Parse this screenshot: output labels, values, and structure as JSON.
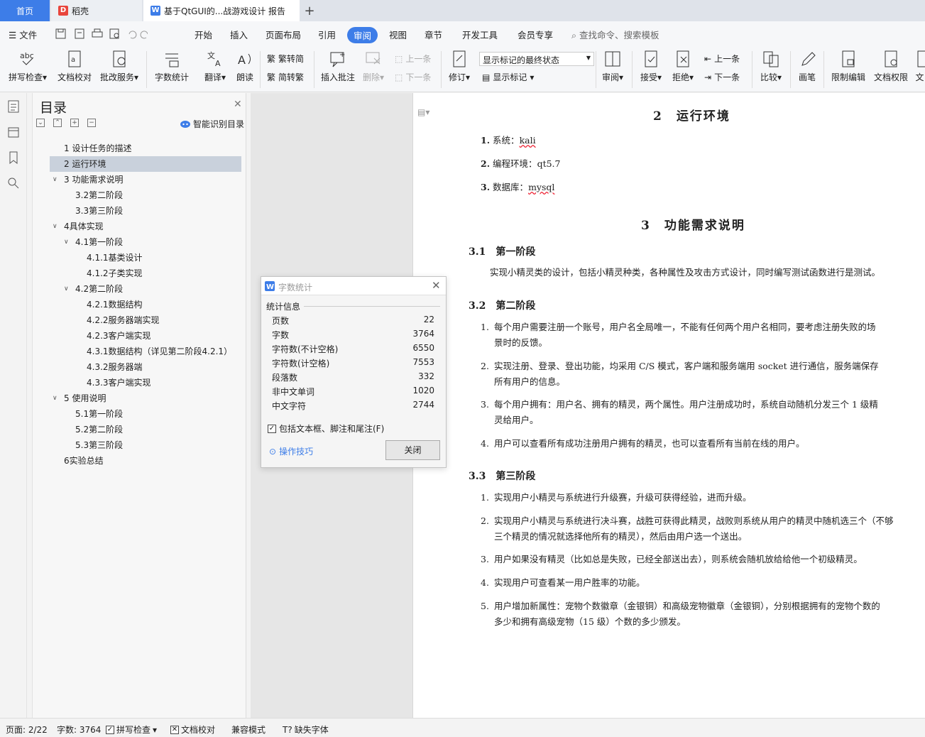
{
  "tabs": {
    "home": "首页",
    "daoke": "稻壳",
    "doc": "基于QtGUI的...战游戏设计 报告"
  },
  "menu": {
    "file": "文件",
    "items": [
      "开始",
      "插入",
      "页面布局",
      "引用",
      "审阅",
      "视图",
      "章节",
      "开发工具",
      "会员专享"
    ],
    "search": "查找命令、搜索模板"
  },
  "ribbon": {
    "spell": "拼写检查",
    "proof": "文档校对",
    "batch": "批改服务",
    "wordcount": "字数统计",
    "translate": "翻译",
    "read": "朗读",
    "trad": "繁转简",
    "simp": "简转繁",
    "insert_comment": "插入批注",
    "delete": "删除",
    "prev": "上一条",
    "next": "下一条",
    "revise": "修订",
    "markup_state": "显示标记的最终状态",
    "show_markup": "显示标记",
    "review": "审阅",
    "accept": "接受",
    "reject": "拒绝",
    "prev2": "上一条",
    "next2": "下一条",
    "compare": "比较",
    "pen": "画笔",
    "restrict": "限制编辑",
    "rights": "文档权限",
    "more": "文"
  },
  "toc": {
    "title": "目录",
    "smart": "智能识别目录",
    "items": [
      "1 设计任务的描述",
      "2 运行环境",
      "3 功能需求说明",
      "3.2第二阶段",
      "3.3第三阶段",
      "4具体实现",
      "4.1第一阶段",
      "4.1.1基类设计",
      "4.1.2子类实现",
      "4.2第二阶段",
      "4.2.1数据结构",
      "4.2.2服务器端实现",
      "4.2.3客户端实现",
      "4.3.1数据结构（详见第二阶段4.2.1）",
      "4.3.2服务器端",
      "4.3.3客户端实现",
      "5 使用说明",
      "5.1第一阶段",
      "5.2第二阶段",
      "5.3第三阶段",
      "6实验总结"
    ]
  },
  "doc": {
    "h_env": "2　运行环境",
    "env": [
      {
        "n": "1.",
        "label": "系统：",
        "val": "kali"
      },
      {
        "n": "2.",
        "label": "编程环境：",
        "val": "qt5.7"
      },
      {
        "n": "3.",
        "label": "数据库：",
        "val": "mysql"
      }
    ],
    "h_func": "3　功能需求说明",
    "s31": "3.1　第一阶段",
    "p31": "实现小精灵类的设计，包括小精灵种类，各种属性及攻击方式设计，同时编写测试函数进行是测试。",
    "s32": "3.2　第二阶段",
    "l32": [
      {
        "n": "1.",
        "a": "每个用户需要注册一个账号，用户名全局唯一，不能有任何两个用户名相同，要考虑注册失败的场",
        "b": "景时的反馈。"
      },
      {
        "n": "2.",
        "a": "实现注册、登录、登出功能，均采用 C/S 模式，客户端和服务端用 socket 进行通信，服务端保存",
        "b": "所有用户的信息。"
      },
      {
        "n": "3.",
        "a": "每个用户拥有：用户名、拥有的精灵，两个属性。用户注册成功时，系统自动随机分发三个 1 级精",
        "b": "灵给用户。"
      },
      {
        "n": "4.",
        "a": "用户可以查看所有成功注册用户拥有的精灵，也可以查看所有当前在线的用户。",
        "b": ""
      }
    ],
    "s33": "3.3　第三阶段",
    "l33": [
      {
        "n": "1.",
        "a": "实现用户小精灵与系统进行升级赛，升级可获得经验，进而升级。",
        "b": ""
      },
      {
        "n": "2.",
        "a": "实现用户小精灵与系统进行决斗赛，战胜可获得此精灵，战败则系统从用户的精灵中随机选三个（不够",
        "b": "三个精灵的情况就选择他所有的精灵），然后由用户选一个送出。"
      },
      {
        "n": "3.",
        "a": "用户如果没有精灵（比如总是失败，已经全部送出去），则系统会随机放给给他一个初级精灵。",
        "b": ""
      },
      {
        "n": "4.",
        "a": "实现用户可查看某一用户胜率的功能。",
        "b": ""
      },
      {
        "n": "5.",
        "a": "用户增加新属性：宠物个数徽章（金银铜）和高级宠物徽章（金银铜），分别根据拥有的宠物个数的",
        "b": "多少和拥有高级宠物（15 级）个数的多少颁发。"
      }
    ]
  },
  "dialog": {
    "title": "字数统计",
    "section": "统计信息",
    "rows": [
      {
        "k": "页数",
        "v": "22"
      },
      {
        "k": "字数",
        "v": "3764"
      },
      {
        "k": "字符数(不计空格)",
        "v": "6550"
      },
      {
        "k": "字符数(计空格)",
        "v": "7553"
      },
      {
        "k": "段落数",
        "v": "332"
      },
      {
        "k": "非中文单词",
        "v": "1020"
      },
      {
        "k": "中文字符",
        "v": "2744"
      }
    ],
    "include": "包括文本框、脚注和尾注(F)",
    "tips": "操作技巧",
    "close": "关闭"
  },
  "status": {
    "page": "页面: 2/22",
    "words": "字数: 3764",
    "spell": "拼写检查",
    "proof": "文档校对",
    "compat": "兼容模式",
    "missing_font": "缺失字体"
  },
  "colors": {
    "accent": "#3d7de8",
    "daoke": "#e8453c"
  }
}
